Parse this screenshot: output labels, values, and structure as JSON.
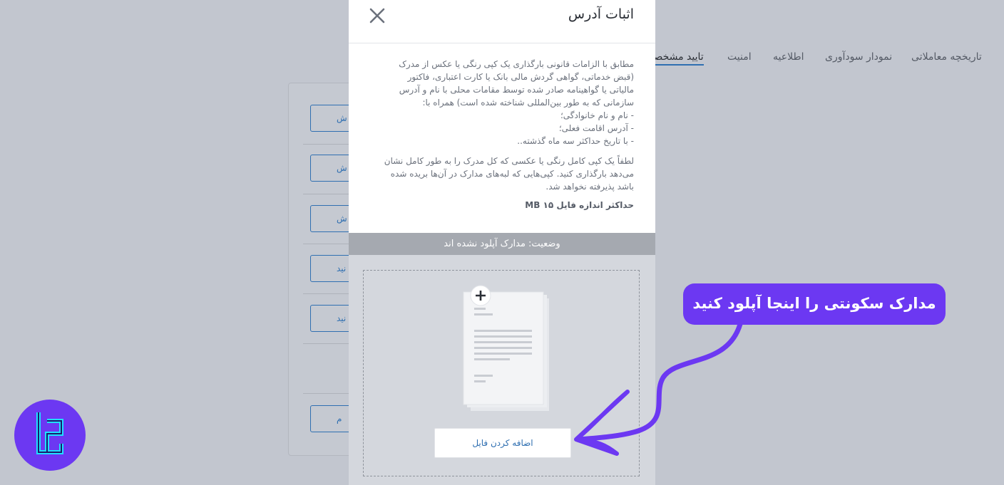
{
  "tabs": [
    {
      "label": "تاریخچه معاملاتی",
      "active": false
    },
    {
      "label": "نمودار سودآوری",
      "active": false
    },
    {
      "label": "اطلاعیه",
      "active": false
    },
    {
      "label": "امنیت",
      "active": false
    },
    {
      "label": "تایید مشخصات",
      "active": true
    }
  ],
  "background_buttons": [
    "ش",
    "ش",
    "ش",
    "نید",
    "نید",
    "م"
  ],
  "modal": {
    "title": "اثبات آدرس",
    "close_icon": "close-icon",
    "description_1": "مطابق با الزامات قانونی بارگذاری یک کپی رنگی یا عکس از مدرک\n(قبض خدماتی، گواهی گردش مالی بانک یا کارت اعتباری، فاکتور\nمالیاتی یا گواهینامه صادر شده توسط مقامات محلی با نام و آدرس\nسازمانی که به طور بین‌المللی شناخته شده است) همراه با:\n- نام و نام خانوادگی؛\n- آدرس اقامت فعلی؛\n- با تاریخ حداکثر سه ماه گذشته..",
    "description_2": "لطفاً یک کپی کامل رنگی یا عکسی که کل مدرک را به طور کامل نشان\nمی‌دهد بارگذاری کنید. کپی‌هایی که لبه‌های مدارک در آن‌ها بریده شده\nباشد پذیرفته نخواهد شد.",
    "max_size": "حداکثر اندازه فایل ۱۵ MB",
    "status": "وضعیت: مدارک آپلود نشده اند",
    "add_file_label": "اضافه کردن فایل",
    "document_icon": "document-plus-icon"
  },
  "annotation": {
    "text": "مدارک سکونتی را اینجا آپلود کنید",
    "color": "#6c38f2"
  },
  "colors": {
    "accent": "#2f6fb1",
    "annotation": "#6c38f2",
    "overlay": "#c2c6cf"
  }
}
